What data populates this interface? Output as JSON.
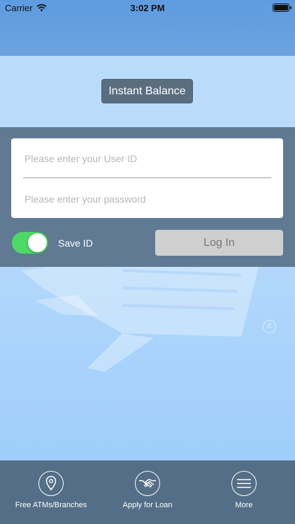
{
  "status_bar": {
    "carrier": "Carrier",
    "time": "3:02 PM"
  },
  "instant_balance": {
    "label": "Instant Balance"
  },
  "login": {
    "user_id_placeholder": "Please enter your User ID",
    "password_placeholder": "Please enter your password",
    "save_id_label": "Save ID",
    "save_id_on": true,
    "login_label": "Log In"
  },
  "tabs": [
    {
      "label": "Free ATMs/Branches",
      "icon": "location-pin-icon"
    },
    {
      "label": "Apply for Loan",
      "icon": "handshake-icon"
    },
    {
      "label": "More",
      "icon": "hamburger-menu-icon"
    }
  ],
  "watermark_mark": "®",
  "colors": {
    "header": "#5e9be0",
    "panel": "#607a94",
    "toggle_on": "#4cd964",
    "tab_bar": "#546e87"
  }
}
